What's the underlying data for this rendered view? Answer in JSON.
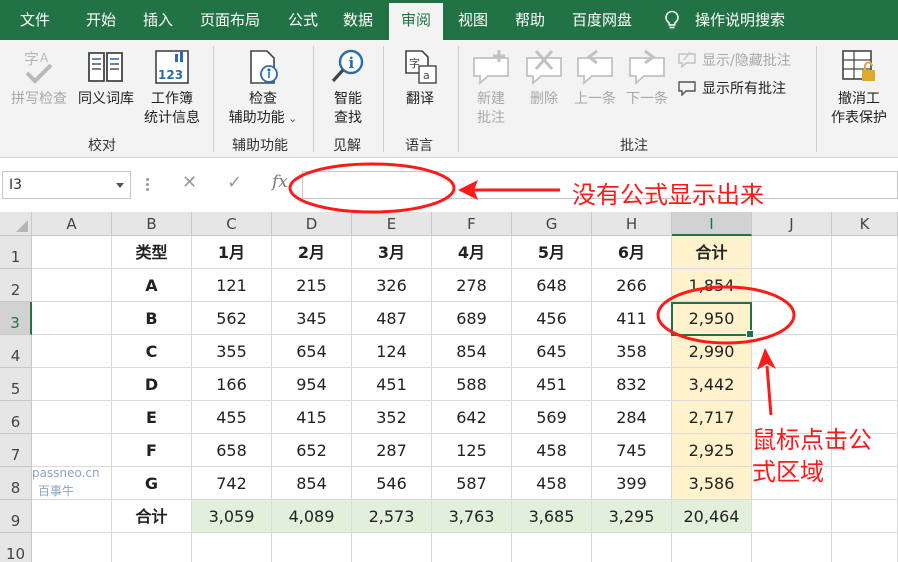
{
  "menu": {
    "tabs": [
      "文件",
      "开始",
      "插入",
      "页面布局",
      "公式",
      "数据",
      "审阅",
      "视图",
      "帮助",
      "百度网盘"
    ],
    "active_tab": "审阅",
    "tell_me": "操作说明搜索"
  },
  "ribbon": {
    "spelling": "拼写检查",
    "thesaurus": "同义词库",
    "workbook_stats_1": "工作簿",
    "workbook_stats_2": "统计信息",
    "check_access_1": "检查",
    "check_access_2": "辅助功能",
    "smart_lookup_1": "智能",
    "smart_lookup_2": "查找",
    "translate": "翻译",
    "new_comment_1": "新建",
    "new_comment_2": "批注",
    "delete": "删除",
    "previous": "上一条",
    "next": "下一条",
    "show_hide_comment": "显示/隐藏批注",
    "show_all_comments": "显示所有批注",
    "unprotect_1": "撤消工",
    "unprotect_2": "作表保护",
    "groups": {
      "proofing": "校对",
      "accessibility": "辅助功能",
      "insights": "见解",
      "language": "语言",
      "comments": "批注"
    },
    "num_icon_text": "123"
  },
  "formula_bar": {
    "name_box": "I3",
    "formula": "",
    "fx": "fx"
  },
  "sheet": {
    "columns": [
      "A",
      "B",
      "C",
      "D",
      "E",
      "F",
      "G",
      "H",
      "I",
      "J",
      "K"
    ],
    "selected_column": "I",
    "rows": [
      "1",
      "2",
      "3",
      "4",
      "5",
      "6",
      "7",
      "8",
      "9",
      "10"
    ],
    "selected_row": "3",
    "header": [
      "类型",
      "1月",
      "2月",
      "3月",
      "4月",
      "5月",
      "6月",
      "合计"
    ],
    "data": [
      [
        "A",
        "121",
        "215",
        "326",
        "278",
        "648",
        "266",
        "1,854"
      ],
      [
        "B",
        "562",
        "345",
        "487",
        "689",
        "456",
        "411",
        "2,950"
      ],
      [
        "C",
        "355",
        "654",
        "124",
        "854",
        "645",
        "358",
        "2,990"
      ],
      [
        "D",
        "166",
        "954",
        "451",
        "588",
        "451",
        "832",
        "3,442"
      ],
      [
        "E",
        "455",
        "415",
        "352",
        "642",
        "569",
        "284",
        "2,717"
      ],
      [
        "F",
        "658",
        "652",
        "287",
        "125",
        "458",
        "745",
        "2,925"
      ],
      [
        "G",
        "742",
        "854",
        "546",
        "587",
        "458",
        "399",
        "3,586"
      ]
    ],
    "total": [
      "合计",
      "3,059",
      "4,089",
      "2,573",
      "3,763",
      "3,685",
      "3,295",
      "20,464"
    ]
  },
  "annotations": {
    "no_formula": "没有公式显示出来",
    "click_line1": "鼠标点击公",
    "click_line2": "式区域",
    "color": "#ff1a1a"
  },
  "watermark": {
    "line1": "passneo.cn",
    "line2": "百事牛"
  },
  "colors": {
    "excel_green": "#217346",
    "sum_column": "#fff2cc",
    "total_row": "#e2efda"
  }
}
